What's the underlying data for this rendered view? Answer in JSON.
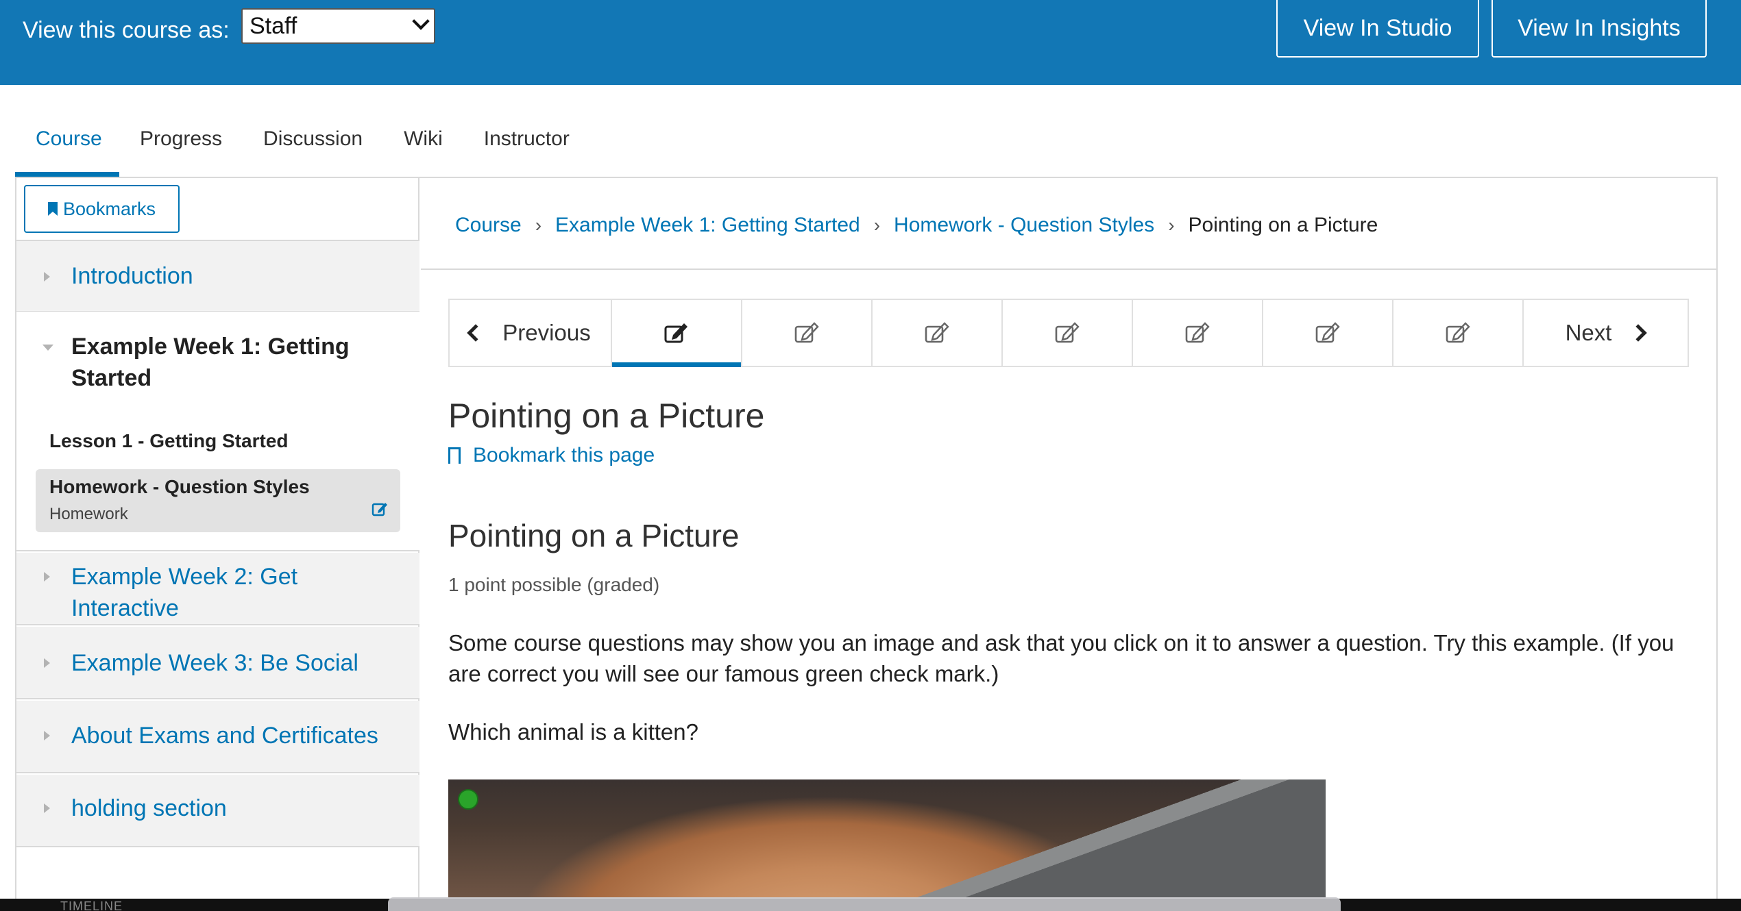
{
  "staff_bar": {
    "label": "View this course as:",
    "role_value": "Staff",
    "studio_button": "View In Studio",
    "insights_button": "View In Insights"
  },
  "tabs": [
    {
      "label": "Course",
      "active": true
    },
    {
      "label": "Progress"
    },
    {
      "label": "Discussion"
    },
    {
      "label": "Wiki"
    },
    {
      "label": "Instructor"
    }
  ],
  "sidebar": {
    "bookmarks_button": "Bookmarks",
    "sections": [
      {
        "label": "Introduction"
      },
      {
        "label": "Example Week 1: Getting Started",
        "expanded": true
      },
      {
        "label": "Example Week 2: Get Interactive"
      },
      {
        "label": "Example Week 3: Be Social"
      },
      {
        "label": "About Exams and Certificates"
      },
      {
        "label": "holding section"
      }
    ],
    "lesson": "Lesson 1 - Getting Started",
    "subsection": {
      "name": "Homework - Question Styles",
      "type": "Homework"
    }
  },
  "breadcrumb": {
    "items": [
      "Course",
      "Example Week 1: Getting Started",
      "Homework - Question Styles"
    ],
    "current": "Pointing on a Picture"
  },
  "sequence": {
    "previous": "Previous",
    "next": "Next",
    "unit_count": 7,
    "active_index": 0
  },
  "content": {
    "page_title": "Pointing on a Picture",
    "bookmark_link": "Bookmark this page",
    "problem_title": "Pointing on a Picture",
    "points": "1 point possible (graded)",
    "prompt": "Some course questions may show you an image and ask that you click on it to answer a question. Try this example. (If you are correct you will see our famous green check mark.)",
    "question": "Which animal is a kitten?"
  },
  "dock": {
    "timeline_label": "TIMELINE"
  },
  "colors": {
    "brand_blue": "#1277b5",
    "link_blue": "#0075b4",
    "marker_green": "#2aa42a"
  }
}
